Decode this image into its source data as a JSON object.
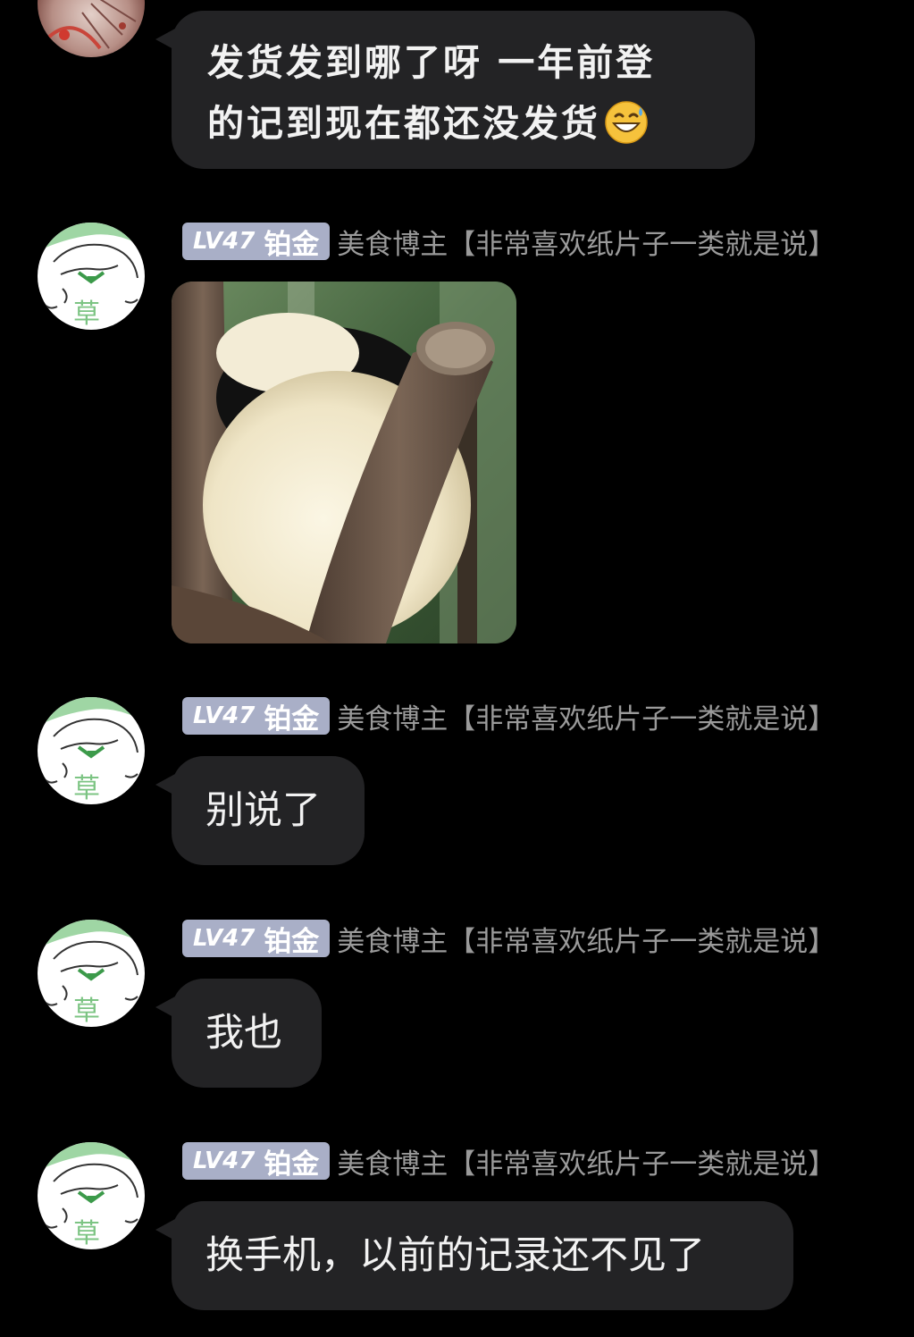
{
  "messages": [
    {
      "id": "m1",
      "text_line1": "发货发到哪了呀 一年前登",
      "text_line2": "的记到现在都还没发货",
      "emoji": "grinning-sweat-emoji"
    },
    {
      "id": "m2",
      "level": "LV47",
      "tier": "铂金",
      "title": "美食博主【非常喜欢纸片子一类就是说】",
      "image": "panda-on-tree-photo"
    },
    {
      "id": "m3",
      "level": "LV47",
      "tier": "铂金",
      "title": "美食博主【非常喜欢纸片子一类就是说】",
      "text": "别说了"
    },
    {
      "id": "m4",
      "level": "LV47",
      "tier": "铂金",
      "title": "美食博主【非常喜欢纸片子一类就是说】",
      "text": "我也"
    },
    {
      "id": "m5",
      "level": "LV47",
      "tier": "铂金",
      "title": "美食博主【非常喜欢纸片子一类就是说】",
      "text": "换手机，以前的记录还不见了"
    }
  ],
  "avatar_char": "草",
  "colors": {
    "background": "#000000",
    "bubble": "#232325",
    "badge": "#a9afc7",
    "title_text": "#9a9a9a",
    "avatar_green": "#9fd6a4"
  }
}
